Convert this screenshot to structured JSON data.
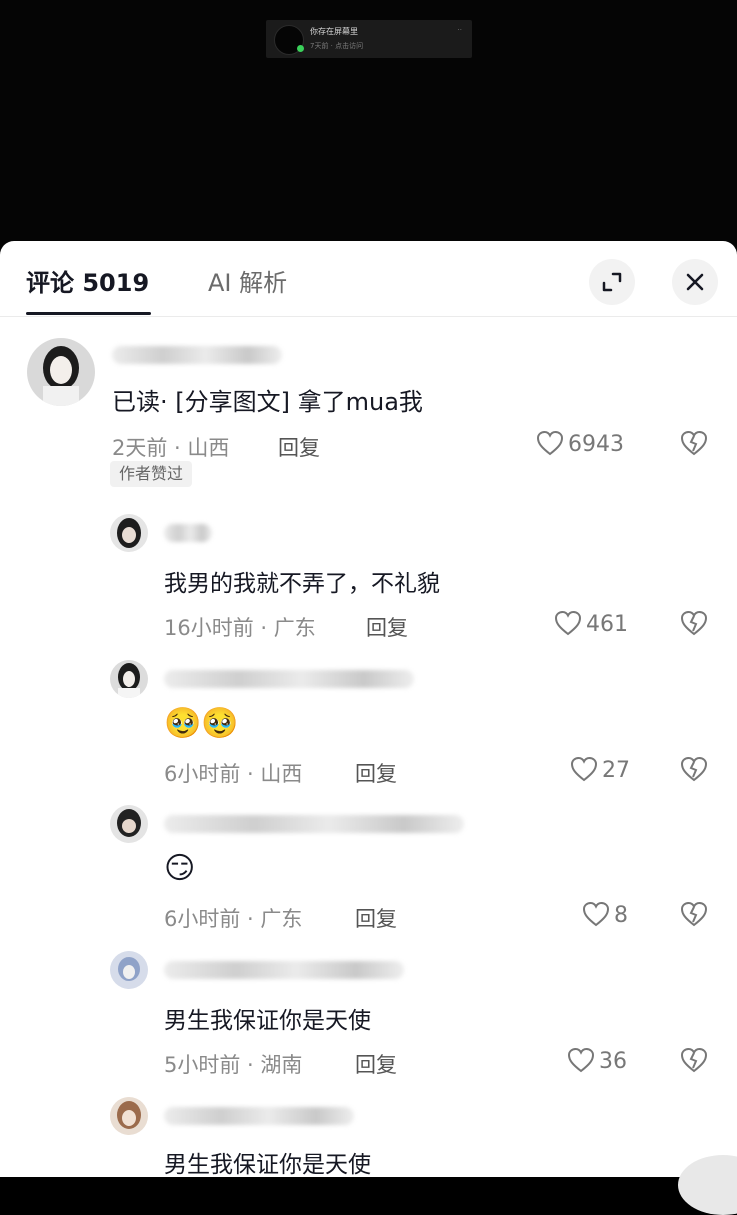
{
  "video": {
    "title": "你存在屏幕里",
    "subtitle": "7天前 · 点击访问"
  },
  "tabs": {
    "comments_label": "评论 5019",
    "ai_label": "AI 解析"
  },
  "icons": {
    "expand": "expand-icon",
    "close": "close-icon",
    "like": "heart-outline-icon",
    "dislike": "broken-heart-icon"
  },
  "comments": [
    {
      "text": "已读· [分享图文] 拿了mua我",
      "meta": "2天前 · 山西",
      "reply": "回复",
      "likes": "6943",
      "badge": "作者赞过"
    },
    {
      "text": "我男的我就不弄了，不礼貌",
      "meta": "16小时前 · 广东",
      "reply": "回复",
      "likes": "461"
    },
    {
      "text": "",
      "emoji": "🥹🥹",
      "meta": "6小时前 · 山西",
      "reply": "回复",
      "likes": "27"
    },
    {
      "text": "",
      "emoji": "😏",
      "meta": "6小时前 · 广东",
      "reply": "回复",
      "likes": "8"
    },
    {
      "text": "男生我保证你是天使",
      "meta": "5小时前 · 湖南",
      "reply": "回复",
      "likes": "36"
    },
    {
      "text": "男生我保证你是天使"
    }
  ],
  "colors": {
    "background": "#000000",
    "sheet": "#ffffff",
    "primary_text": "#161823",
    "secondary_text": "#8a8a8a"
  }
}
